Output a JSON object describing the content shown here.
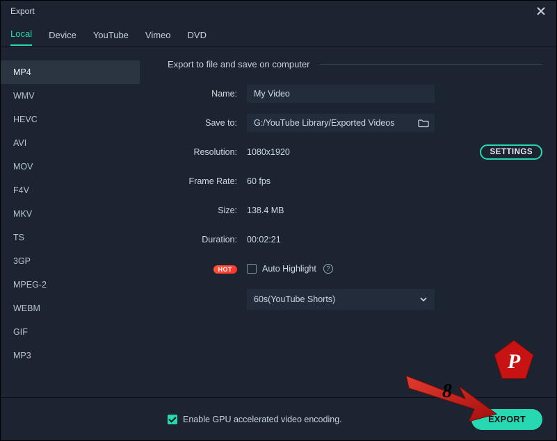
{
  "window": {
    "title": "Export"
  },
  "tabs": [
    "Local",
    "Device",
    "YouTube",
    "Vimeo",
    "DVD"
  ],
  "active_tab": 0,
  "sidebar": {
    "formats": [
      "MP4",
      "WMV",
      "HEVC",
      "AVI",
      "MOV",
      "F4V",
      "MKV",
      "TS",
      "3GP",
      "MPEG-2",
      "WEBM",
      "GIF",
      "MP3"
    ],
    "active_index": 0
  },
  "section_label": "Export to file and save on computer",
  "fields": {
    "name_label": "Name:",
    "name_value": "My Video",
    "saveto_label": "Save to:",
    "saveto_value": "G:/YouTube Library/Exported Videos",
    "resolution_label": "Resolution:",
    "resolution_value": "1080x1920",
    "settings_btn": "SETTINGS",
    "framerate_label": "Frame Rate:",
    "framerate_value": "60 fps",
    "size_label": "Size:",
    "size_value": "138.4 MB",
    "duration_label": "Duration:",
    "duration_value": "00:02:21",
    "hot_badge": "HOT",
    "auto_highlight_label": "Auto Highlight",
    "auto_highlight_checked": false,
    "highlight_select_value": "60s(YouTube Shorts)"
  },
  "footer": {
    "gpu_checked": true,
    "gpu_label": "Enable GPU accelerated video encoding.",
    "export_btn": "EXPORT"
  },
  "annotation": {
    "step_number": "8",
    "pentagon_letter": "P"
  },
  "colors": {
    "accent": "#26d9b3",
    "bg": "#1b2430",
    "arrow": "#c71313"
  }
}
